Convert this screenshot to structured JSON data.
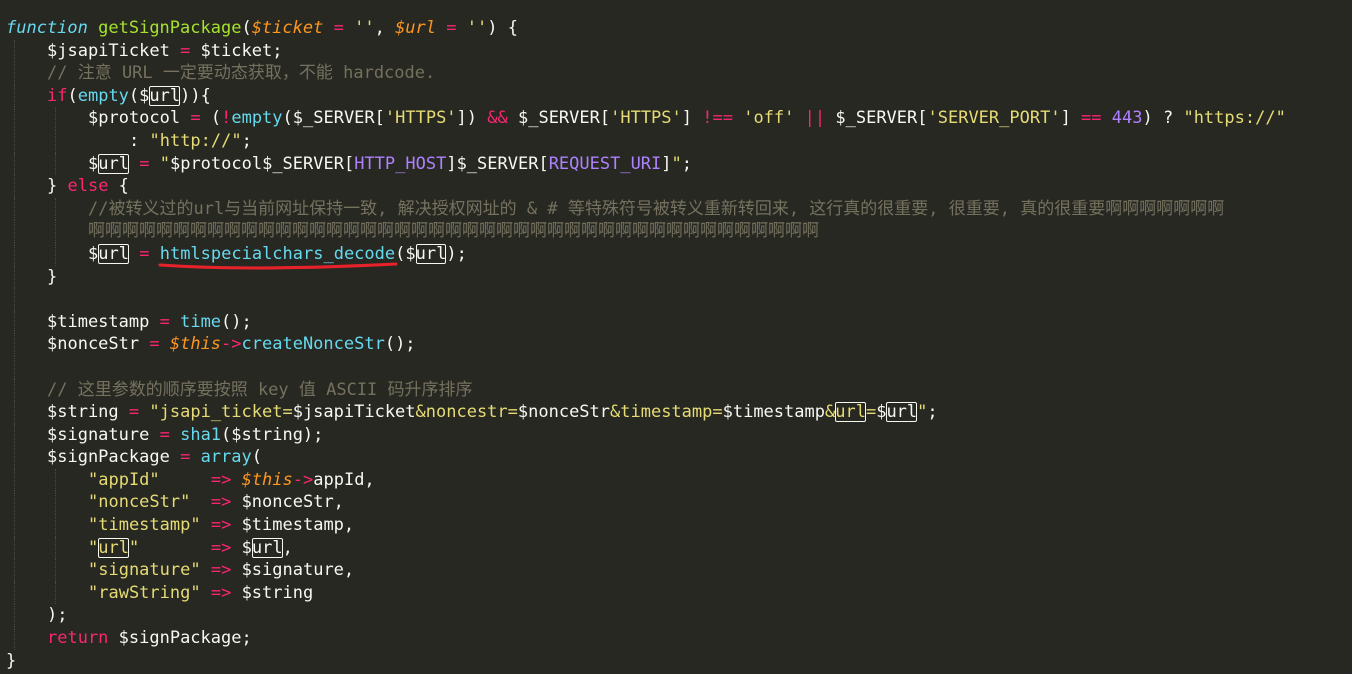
{
  "editor": {
    "lines": [
      {
        "indent": 0,
        "tokens": [
          {
            "c": "sk",
            "t": "function"
          },
          {
            "c": "pl",
            "t": " "
          },
          {
            "c": "fn",
            "t": "getSignPackage"
          },
          {
            "c": "pl",
            "t": "("
          },
          {
            "c": "pa",
            "t": "$ticket"
          },
          {
            "c": "pl",
            "t": " "
          },
          {
            "c": "kw",
            "t": "="
          },
          {
            "c": "pl",
            "t": " "
          },
          {
            "c": "st",
            "t": "''"
          },
          {
            "c": "pl",
            "t": ", "
          },
          {
            "c": "pa",
            "t": "$url"
          },
          {
            "c": "pl",
            "t": " "
          },
          {
            "c": "kw",
            "t": "="
          },
          {
            "c": "pl",
            "t": " "
          },
          {
            "c": "st",
            "t": "''"
          },
          {
            "c": "pl",
            "t": ") {"
          }
        ]
      },
      {
        "indent": 1,
        "tokens": [
          {
            "c": "pl",
            "t": "$jsapiTicket "
          },
          {
            "c": "kw",
            "t": "="
          },
          {
            "c": "pl",
            "t": " $ticket;"
          }
        ]
      },
      {
        "indent": 1,
        "tokens": [
          {
            "c": "cm",
            "t": "// 注意 URL 一定要动态获取，不能 hardcode."
          }
        ]
      },
      {
        "indent": 1,
        "tokens": [
          {
            "c": "kw",
            "t": "if"
          },
          {
            "c": "pl",
            "t": "("
          },
          {
            "c": "bi",
            "t": "empty"
          },
          {
            "c": "pl",
            "t": "($"
          },
          {
            "c": "pl",
            "t": "url",
            "hl": true
          },
          {
            "c": "pl",
            "t": ")){"
          }
        ]
      },
      {
        "indent": 2,
        "tokens": [
          {
            "c": "pl",
            "t": "$protocol "
          },
          {
            "c": "kw",
            "t": "="
          },
          {
            "c": "pl",
            "t": " ("
          },
          {
            "c": "kw",
            "t": "!"
          },
          {
            "c": "bi",
            "t": "empty"
          },
          {
            "c": "pl",
            "t": "($_SERVER["
          },
          {
            "c": "st",
            "t": "'HTTPS'"
          },
          {
            "c": "pl",
            "t": "]) "
          },
          {
            "c": "kw",
            "t": "&&"
          },
          {
            "c": "pl",
            "t": " $_SERVER["
          },
          {
            "c": "st",
            "t": "'HTTPS'"
          },
          {
            "c": "pl",
            "t": "] "
          },
          {
            "c": "kw",
            "t": "!=="
          },
          {
            "c": "pl",
            "t": " "
          },
          {
            "c": "st",
            "t": "'off'"
          },
          {
            "c": "pl",
            "t": " "
          },
          {
            "c": "kw",
            "t": "||"
          },
          {
            "c": "pl",
            "t": " $_SERVER["
          },
          {
            "c": "st",
            "t": "'SERVER_PORT'"
          },
          {
            "c": "pl",
            "t": "] "
          },
          {
            "c": "kw",
            "t": "=="
          },
          {
            "c": "pl",
            "t": " "
          },
          {
            "c": "nu",
            "t": "443"
          },
          {
            "c": "pl",
            "t": ") ? "
          },
          {
            "c": "st",
            "t": "\"https://\""
          }
        ]
      },
      {
        "indent": 3,
        "tokens": [
          {
            "c": "pl",
            "t": ": "
          },
          {
            "c": "st",
            "t": "\"http://\""
          },
          {
            "c": "pl",
            "t": ";"
          }
        ]
      },
      {
        "indent": 2,
        "tokens": [
          {
            "c": "pl",
            "t": "$"
          },
          {
            "c": "pl",
            "t": "url",
            "hl": true
          },
          {
            "c": "pl",
            "t": " "
          },
          {
            "c": "kw",
            "t": "="
          },
          {
            "c": "pl",
            "t": " "
          },
          {
            "c": "st",
            "t": "\""
          },
          {
            "c": "pl",
            "t": "$protocol$_SERVER["
          },
          {
            "c": "ct",
            "t": "HTTP_HOST"
          },
          {
            "c": "pl",
            "t": "]$_SERVER["
          },
          {
            "c": "ct",
            "t": "REQUEST_URI"
          },
          {
            "c": "pl",
            "t": "]"
          },
          {
            "c": "st",
            "t": "\""
          },
          {
            "c": "pl",
            "t": ";"
          }
        ]
      },
      {
        "indent": 1,
        "tokens": [
          {
            "c": "pl",
            "t": "} "
          },
          {
            "c": "kw",
            "t": "else"
          },
          {
            "c": "pl",
            "t": " {"
          }
        ]
      },
      {
        "indent": 2,
        "tokens": [
          {
            "c": "cm",
            "t": "//被转义过的url与当前网址保持一致, 解决授权网址的 & # 等特殊符号被转义重新转回来, 这行真的很重要, 很重要, 真的很重要啊啊啊啊啊啊啊"
          }
        ]
      },
      {
        "indent": 2,
        "tokens": [
          {
            "c": "cm",
            "t": "啊啊啊啊啊啊啊啊啊啊啊啊啊啊啊啊啊啊啊啊啊啊啊啊啊啊啊啊啊啊啊啊啊啊啊啊啊啊啊啊啊啊啊"
          }
        ]
      },
      {
        "indent": 2,
        "tokens": [
          {
            "c": "pl",
            "t": "$"
          },
          {
            "c": "pl",
            "t": "url",
            "hl": true
          },
          {
            "c": "pl",
            "t": " "
          },
          {
            "c": "kw",
            "t": "="
          },
          {
            "c": "pl",
            "t": " "
          },
          {
            "c": "bi",
            "t": "htmlspecialchars_decode"
          },
          {
            "c": "pl",
            "t": "($"
          },
          {
            "c": "pl",
            "t": "url",
            "hl": true
          },
          {
            "c": "pl",
            "t": ");"
          }
        ]
      },
      {
        "indent": 1,
        "tokens": [
          {
            "c": "pl",
            "t": "}"
          }
        ]
      },
      {
        "indent": 1,
        "tokens": []
      },
      {
        "indent": 1,
        "tokens": [
          {
            "c": "pl",
            "t": "$timestamp "
          },
          {
            "c": "kw",
            "t": "="
          },
          {
            "c": "pl",
            "t": " "
          },
          {
            "c": "bi",
            "t": "time"
          },
          {
            "c": "pl",
            "t": "();"
          }
        ]
      },
      {
        "indent": 1,
        "tokens": [
          {
            "c": "pl",
            "t": "$nonceStr "
          },
          {
            "c": "kw",
            "t": "="
          },
          {
            "c": "pl",
            "t": " "
          },
          {
            "c": "pa",
            "t": "$this"
          },
          {
            "c": "kw",
            "t": "->"
          },
          {
            "c": "bi",
            "t": "createNonceStr"
          },
          {
            "c": "pl",
            "t": "();"
          }
        ]
      },
      {
        "indent": 1,
        "tokens": []
      },
      {
        "indent": 1,
        "tokens": [
          {
            "c": "cm",
            "t": "// 这里参数的顺序要按照 key 值 ASCII 码升序排序"
          }
        ]
      },
      {
        "indent": 1,
        "tokens": [
          {
            "c": "pl",
            "t": "$string "
          },
          {
            "c": "kw",
            "t": "="
          },
          {
            "c": "pl",
            "t": " "
          },
          {
            "c": "st",
            "t": "\""
          },
          {
            "c": "st",
            "t": "jsapi_ticket="
          },
          {
            "c": "pl",
            "t": "$jsapiTicket"
          },
          {
            "c": "st",
            "t": "&noncestr="
          },
          {
            "c": "pl",
            "t": "$nonceStr"
          },
          {
            "c": "st",
            "t": "&timestamp="
          },
          {
            "c": "pl",
            "t": "$timestamp"
          },
          {
            "c": "st",
            "t": "&"
          },
          {
            "c": "st",
            "t": "url",
            "hl": true
          },
          {
            "c": "st",
            "t": "="
          },
          {
            "c": "pl",
            "t": "$"
          },
          {
            "c": "pl",
            "t": "url",
            "hl": true
          },
          {
            "c": "st",
            "t": "\""
          },
          {
            "c": "pl",
            "t": ";"
          }
        ]
      },
      {
        "indent": 1,
        "tokens": [
          {
            "c": "pl",
            "t": "$signature "
          },
          {
            "c": "kw",
            "t": "="
          },
          {
            "c": "pl",
            "t": " "
          },
          {
            "c": "bi",
            "t": "sha1"
          },
          {
            "c": "pl",
            "t": "($string);"
          }
        ]
      },
      {
        "indent": 1,
        "tokens": [
          {
            "c": "pl",
            "t": "$signPackage "
          },
          {
            "c": "kw",
            "t": "="
          },
          {
            "c": "pl",
            "t": " "
          },
          {
            "c": "bi",
            "t": "array"
          },
          {
            "c": "pl",
            "t": "("
          }
        ]
      },
      {
        "indent": 2,
        "tokens": [
          {
            "c": "st",
            "t": "\"appId\""
          },
          {
            "c": "pl",
            "t": "     "
          },
          {
            "c": "kw",
            "t": "=>"
          },
          {
            "c": "pl",
            "t": " "
          },
          {
            "c": "pa",
            "t": "$this"
          },
          {
            "c": "kw",
            "t": "->"
          },
          {
            "c": "pl",
            "t": "appId,"
          }
        ]
      },
      {
        "indent": 2,
        "tokens": [
          {
            "c": "st",
            "t": "\"nonceStr\""
          },
          {
            "c": "pl",
            "t": "  "
          },
          {
            "c": "kw",
            "t": "=>"
          },
          {
            "c": "pl",
            "t": " $nonceStr,"
          }
        ]
      },
      {
        "indent": 2,
        "tokens": [
          {
            "c": "st",
            "t": "\"timestamp\""
          },
          {
            "c": "pl",
            "t": " "
          },
          {
            "c": "kw",
            "t": "=>"
          },
          {
            "c": "pl",
            "t": " $timestamp,"
          }
        ]
      },
      {
        "indent": 2,
        "tokens": [
          {
            "c": "st",
            "t": "\""
          },
          {
            "c": "st",
            "t": "url",
            "hl": true
          },
          {
            "c": "st",
            "t": "\""
          },
          {
            "c": "pl",
            "t": "       "
          },
          {
            "c": "kw",
            "t": "=>"
          },
          {
            "c": "pl",
            "t": " $"
          },
          {
            "c": "pl",
            "t": "url",
            "hl": true
          },
          {
            "c": "pl",
            "t": ","
          }
        ]
      },
      {
        "indent": 2,
        "tokens": [
          {
            "c": "st",
            "t": "\"signature\""
          },
          {
            "c": "pl",
            "t": " "
          },
          {
            "c": "kw",
            "t": "=>"
          },
          {
            "c": "pl",
            "t": " $signature,"
          }
        ]
      },
      {
        "indent": 2,
        "tokens": [
          {
            "c": "st",
            "t": "\"rawString\""
          },
          {
            "c": "pl",
            "t": " "
          },
          {
            "c": "kw",
            "t": "=>"
          },
          {
            "c": "pl",
            "t": " $string"
          }
        ]
      },
      {
        "indent": 1,
        "tokens": [
          {
            "c": "pl",
            "t": ");"
          }
        ]
      },
      {
        "indent": 1,
        "tokens": [
          {
            "c": "kw",
            "t": "return"
          },
          {
            "c": "pl",
            "t": " $signPackage;"
          }
        ]
      },
      {
        "indent": 0,
        "tokens": [
          {
            "c": "pl",
            "t": "}"
          }
        ]
      }
    ],
    "colors": {
      "background": "#272822",
      "keyword": "#f92672",
      "function_name": "#a6e22e",
      "string": "#e6db74",
      "comment": "#75715e",
      "number": "#ae81ff",
      "builtin": "#66d9ef",
      "parameter": "#fd971f",
      "annotation_underline": "#e8222a"
    }
  }
}
